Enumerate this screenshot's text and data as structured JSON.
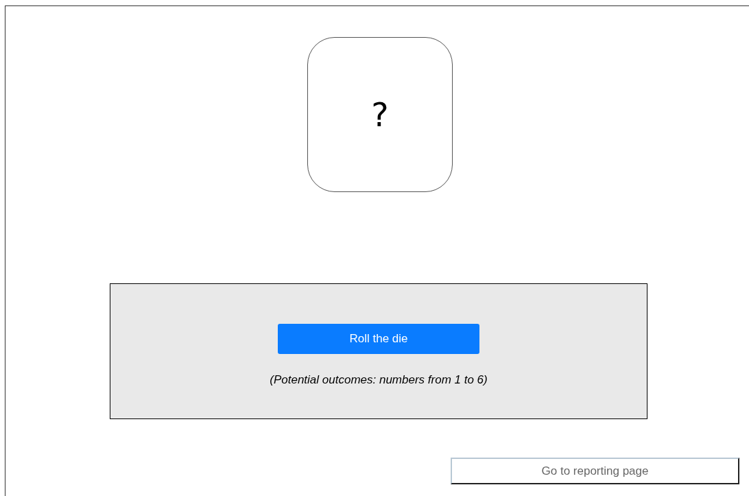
{
  "die": {
    "face": "?"
  },
  "panel": {
    "roll_button": "Roll the die",
    "note": "(Potential outcomes: numbers from 1 to 6)"
  },
  "report_button": "Go to reporting page"
}
